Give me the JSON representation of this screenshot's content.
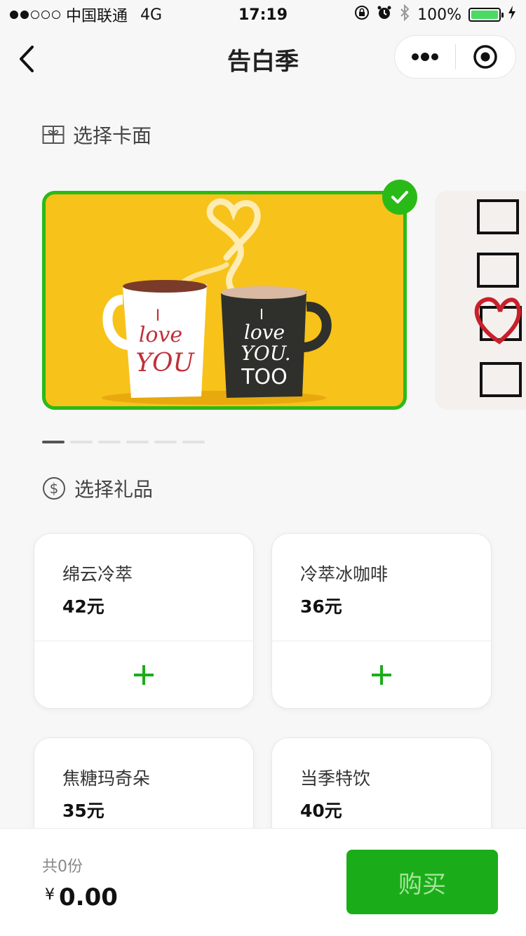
{
  "status": {
    "carrier": "中国联通",
    "network": "4G",
    "time": "17:19",
    "battery": "100%"
  },
  "nav": {
    "title": "告白季"
  },
  "sections": {
    "card": "选择卡面",
    "gift": "选择礼品"
  },
  "card": {
    "mug_left_text": [
      "I",
      "love",
      "YOU"
    ],
    "mug_right_text": [
      "I",
      "love",
      "YOU.",
      "TOO"
    ],
    "indicator_count": 6,
    "active_index": 0
  },
  "gifts": [
    {
      "name": "绵云冷萃",
      "price": "42元"
    },
    {
      "name": "冷萃冰咖啡",
      "price": "36元"
    },
    {
      "name": "焦糖玛奇朵",
      "price": "35元"
    },
    {
      "name": "当季特饮",
      "price": "40元"
    }
  ],
  "footer": {
    "count": "共0份",
    "currency": "¥",
    "amount": "0.00",
    "buy": "购买"
  },
  "colors": {
    "accent": "#1aad19",
    "card_bg": "#f7c21a"
  },
  "icons": {
    "back": "chevron-left-icon",
    "more": "more-dots-icon",
    "close": "target-icon",
    "card_section": "gift-box-icon",
    "gift_section": "dollar-circle-icon",
    "add": "plus-icon",
    "selected": "check-icon"
  }
}
